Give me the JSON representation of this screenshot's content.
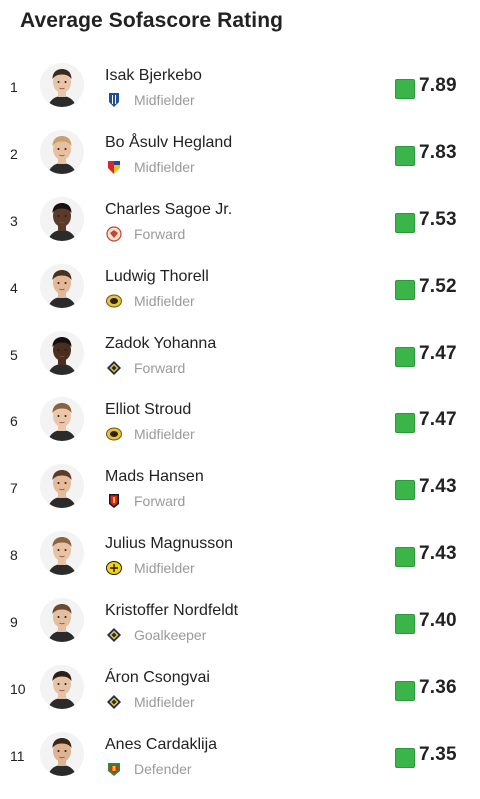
{
  "header": {
    "title": "Average Sofascore Rating"
  },
  "colors": {
    "rating_green": "#3bb54a",
    "rating_green_border": "#2a9a38"
  },
  "players": [
    {
      "rank": "1",
      "name": "Isak Bjerkebo",
      "position": "Midfielder",
      "rating": "7.89",
      "team_icon": "ifk-goteborg-crest-icon",
      "skin": "#e8c4a8",
      "hair": "#3a2a20"
    },
    {
      "rank": "2",
      "name": "Bo Åsulv Hegland",
      "position": "Midfielder",
      "rating": "7.83",
      "team_icon": "djurgarden-crest-icon",
      "skin": "#e6c0a0",
      "hair": "#c9a070"
    },
    {
      "rank": "3",
      "name": "Charles Sagoe Jr.",
      "position": "Forward",
      "rating": "7.53",
      "team_icon": "kalmar-crest-icon",
      "skin": "#5a3a28",
      "hair": "#1a1210"
    },
    {
      "rank": "4",
      "name": "Ludwig Thorell",
      "position": "Midfielder",
      "rating": "7.52",
      "team_icon": "hacken-crest-icon",
      "skin": "#e2b898",
      "hair": "#4a3020"
    },
    {
      "rank": "5",
      "name": "Zadok Yohanna",
      "position": "Forward",
      "rating": "7.47",
      "team_icon": "aik-crest-icon",
      "skin": "#4a2e1e",
      "hair": "#141010"
    },
    {
      "rank": "6",
      "name": "Elliot Stroud",
      "position": "Midfielder",
      "rating": "7.47",
      "team_icon": "hacken-crest-icon",
      "skin": "#ecc6aa",
      "hair": "#8a6040"
    },
    {
      "rank": "7",
      "name": "Mads Hansen",
      "position": "Forward",
      "rating": "7.43",
      "team_icon": "mjallby-crest-icon",
      "skin": "#e4bc9c",
      "hair": "#5a3c28"
    },
    {
      "rank": "8",
      "name": "Julius Magnusson",
      "position": "Midfielder",
      "rating": "7.43",
      "team_icon": "elfsborg-crest-icon",
      "skin": "#e8c2a4",
      "hair": "#8a6444"
    },
    {
      "rank": "9",
      "name": "Kristoffer Nordfeldt",
      "position": "Goalkeeper",
      "rating": "7.40",
      "team_icon": "aik-crest-icon",
      "skin": "#e4bea0",
      "hair": "#6a4a34"
    },
    {
      "rank": "10",
      "name": "Áron Csongvai",
      "position": "Midfielder",
      "rating": "7.36",
      "team_icon": "aik-crest-icon",
      "skin": "#e6c2a6",
      "hair": "#2a1e18"
    },
    {
      "rank": "11",
      "name": "Anes Cardaklija",
      "position": "Defender",
      "rating": "7.35",
      "team_icon": "brommapojkarna-crest-icon",
      "skin": "#dcb494",
      "hair": "#3a2618"
    }
  ]
}
